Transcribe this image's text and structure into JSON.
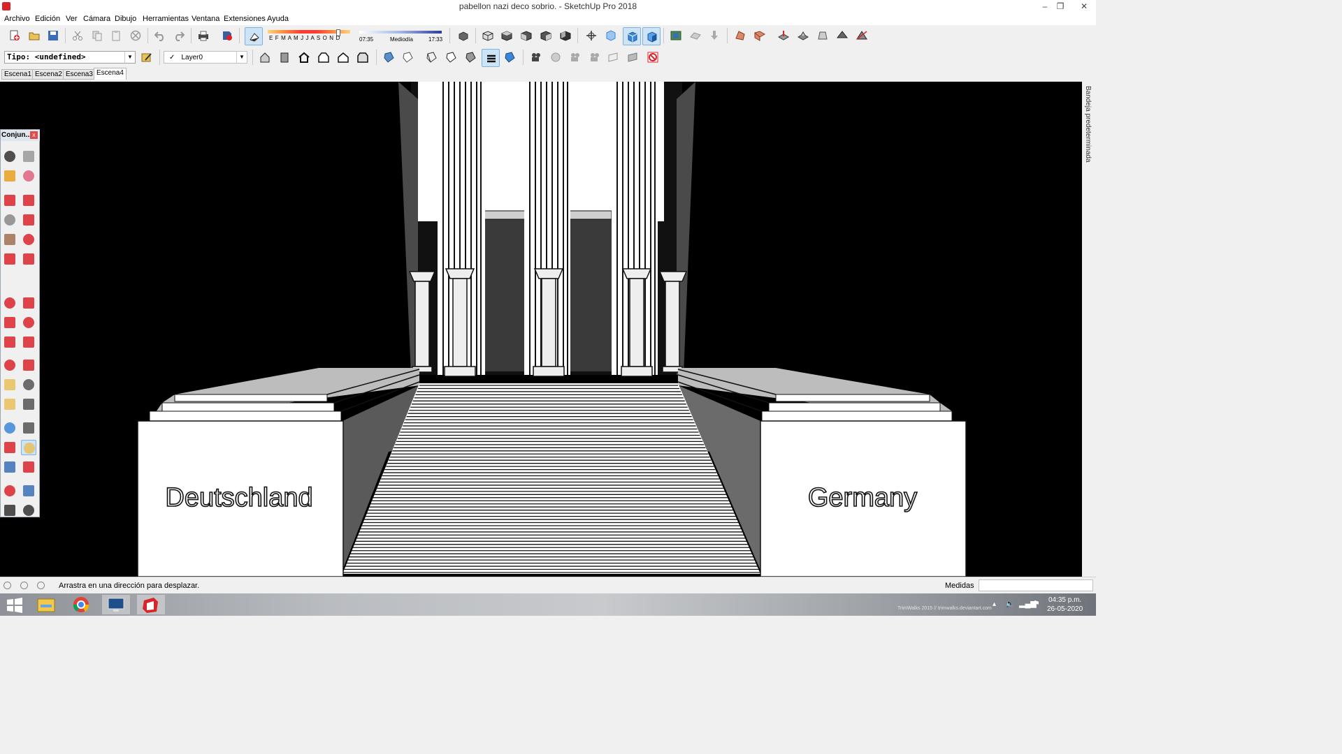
{
  "window": {
    "title": "pabellon nazi deco sobrio. - SketchUp Pro 2018",
    "minimize": "–",
    "restore": "❐",
    "close": "✕"
  },
  "menu": [
    "Archivo",
    "Edición",
    "Ver",
    "Cámara",
    "Dibujo",
    "Herramientas",
    "Ventana",
    "Extensiones",
    "Ayuda"
  ],
  "shadows": {
    "months": "E F M A M J J A S O N D",
    "time_start": "07:35",
    "time_mid": "Mediodía",
    "time_end": "17:33"
  },
  "entity_info": {
    "type_value": "Tipo: <undefined>",
    "layer_check": "✓",
    "layer_value": "Layer0"
  },
  "scenes": [
    "Escena1",
    "Escena2",
    "Escena3",
    "Escena4"
  ],
  "active_scene": "Escena4",
  "viewport": {
    "left_inscription": "Deutschland",
    "right_inscription": "Germany"
  },
  "tray_label": "Bandeja predeterminada",
  "palette_title": "Conjun...",
  "palette_close": "x",
  "status": {
    "message": "Arrastra en una dirección para desplazar.",
    "measurements_label": "Medidas",
    "measurements_value": ""
  },
  "taskbar": {
    "time": "04:35 p.m.",
    "date": "26-05-2020",
    "wallpaper_credit": "TrimWalks 2015 // trimwalks.deviantart.com"
  },
  "icons": {
    "toolbar_main": [
      "new-model-icon",
      "open-icon",
      "save-icon",
      "cut-icon",
      "copy-icon",
      "paste-icon",
      "erase-icon",
      "undo-icon",
      "redo-icon",
      "print-icon",
      "model-info-icon",
      "shadows-toggle-icon"
    ],
    "toolbar_views": [
      "component-icon",
      "iso-view-icon",
      "top-view-icon",
      "front-view-icon",
      "right-view-icon",
      "back-view-icon",
      "left-view-icon"
    ],
    "palette": [
      "select-icon",
      "make-component-icon",
      "paint-bucket-icon",
      "eraser-icon",
      "line-icon",
      "freehand-icon",
      "rectangle-icon",
      "rotated-rectangle-icon",
      "circle-icon",
      "polygon-icon",
      "arc-icon",
      "two-point-arc-icon",
      "three-point-arc-icon",
      "pie-icon",
      "move-icon",
      "push-pull-icon",
      "rotate-icon",
      "follow-me-icon",
      "scale-icon",
      "offset-icon",
      "tape-measure-icon",
      "dimension-icon",
      "protractor-icon",
      "text-icon",
      "axes-icon",
      "3d-text-icon",
      "orbit-icon",
      "pan-icon",
      "zoom-icon",
      "zoom-window-icon",
      "zoom-extents-icon",
      "previous-view-icon",
      "position-camera-icon",
      "look-around-icon",
      "walk-icon",
      "section-plane-icon"
    ]
  },
  "colors": {
    "accent_blue": "#3a86d9",
    "sketchup_red": "#d9252a",
    "viewport_bg": "#000000"
  }
}
